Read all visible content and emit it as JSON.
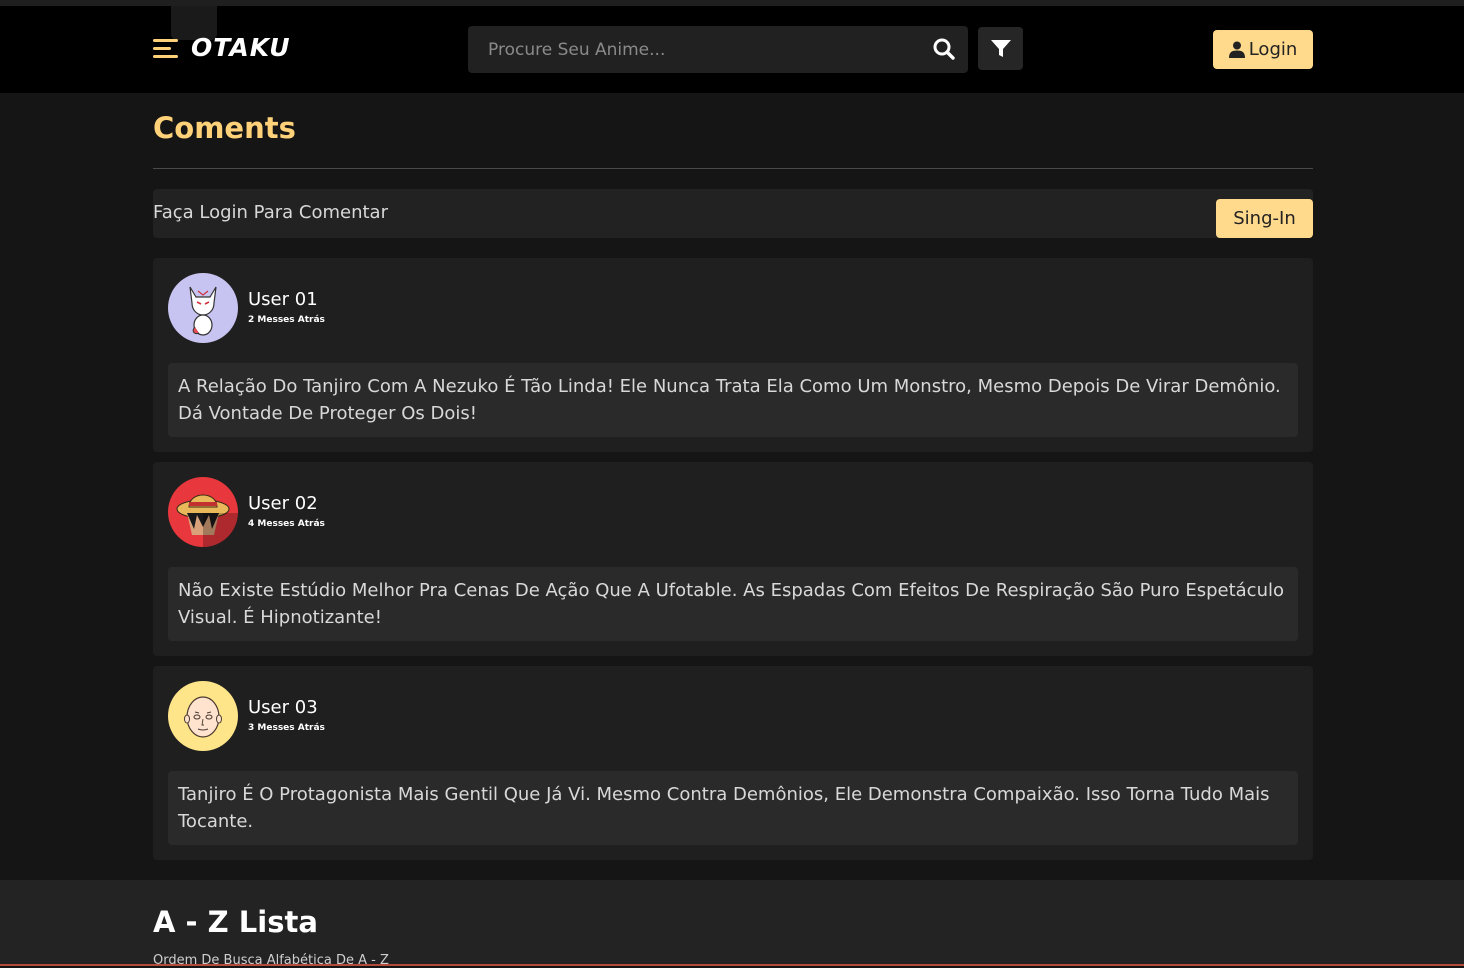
{
  "header": {
    "logo": "OTAKU",
    "search_placeholder": "Procure Seu Anime...",
    "login_label": "Login",
    "accent_color": "#ffd98c"
  },
  "icons": {
    "menu": "menu-icon",
    "search": "search-icon",
    "filter": "filter-icon",
    "user": "user-icon"
  },
  "comments_section": {
    "title": "Coments",
    "login_prompt": "Faça Login Para Comentar",
    "signin_label": "Sing-In",
    "comments": [
      {
        "user": "User 01",
        "time": "2 Messes Atrás",
        "text": "A Relação Do Tanjiro Com A Nezuko É Tão Linda! Ele Nunca Trata Ela Como Um Monstro, Mesmo Depois De Virar Demônio. Dá Vontade De Proteger Os Dois!"
      },
      {
        "user": "User 02",
        "time": "4 Messes Atrás",
        "text": "Não Existe Estúdio Melhor Pra Cenas De Ação Que A Ufotable. As Espadas Com Efeitos De Respiração São Puro Espetáculo Visual. É Hipnotizante!"
      },
      {
        "user": "User 03",
        "time": "3 Messes Atrás",
        "text": "Tanjiro É O Protagonista Mais Gentil Que Já Vi. Mesmo Contra Demônios, Ele Demonstra Compaixão. Isso Torna Tudo Mais Tocante."
      }
    ]
  },
  "az_section": {
    "title": "A - Z Lista",
    "subtitle": "Ordem De Busca Alfabética De A - Z"
  }
}
